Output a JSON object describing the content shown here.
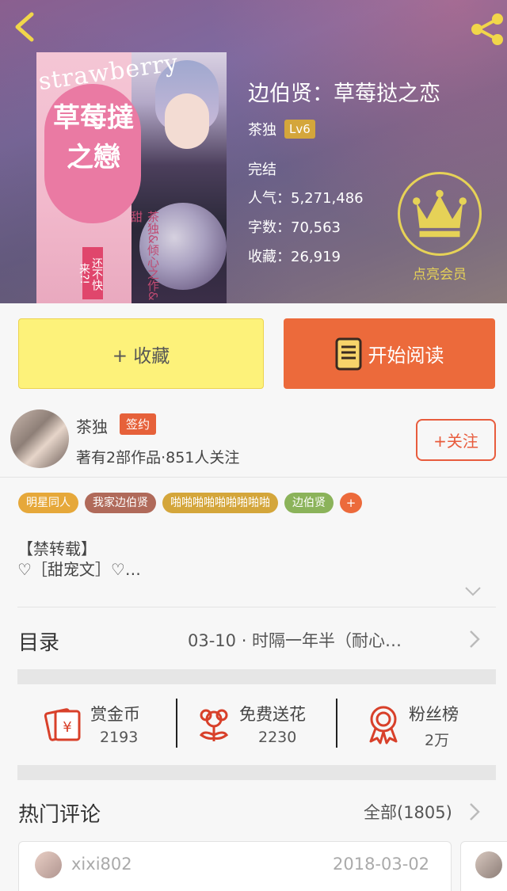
{
  "book": {
    "cover_en": "strawberry",
    "cover_title": "草莓撻之戀",
    "cover_tag": "还不快来?!",
    "cover_vertical": "茶独&倾心之作&甜",
    "title": "边伯贤：草莓挞之恋",
    "author": "茶独",
    "level": "Lv6",
    "status": "完结",
    "popularity": "人气：5,271,486",
    "words": "字数：70,563",
    "collects": "收藏：26,919",
    "vip_label": "点亮会员"
  },
  "actions": {
    "collect_label": "+ 收藏",
    "read_label": "开始阅读"
  },
  "author_section": {
    "name": "茶独",
    "badge": "签约",
    "desc": "著有2部作品·851人关注",
    "follow_label": "+关注"
  },
  "tags": [
    {
      "label": "明星同人",
      "color": "#e6a83a"
    },
    {
      "label": "我家边伯贤",
      "color": "#b06a5a"
    },
    {
      "label": "啪啪啪啪啪啪啪啪啪",
      "color": "#d4a63b"
    },
    {
      "label": "边伯贤",
      "color": "#8bb35a"
    }
  ],
  "tag_more": "+",
  "synopsis": {
    "line1": "【禁转载】",
    "line2": "♡［甜宠文］♡…"
  },
  "toc": {
    "label": "目录",
    "latest": "03-10 · 时隔一年半（耐心…"
  },
  "rewards": [
    {
      "label": "赏金币",
      "value": "2193",
      "icon": "coin-envelope-icon"
    },
    {
      "label": "免费送花",
      "value": "2230",
      "icon": "flower-icon"
    },
    {
      "label": "粉丝榜",
      "value": "2万",
      "icon": "medal-icon"
    }
  ],
  "comments": {
    "title": "热门评论",
    "all_label": "全部(1805)",
    "items": [
      {
        "user": "xixi802",
        "date": "2018-03-02"
      }
    ]
  },
  "colors": {
    "accent_orange": "#ec6a3b",
    "collect_yellow": "#fdf27a",
    "vip_gold": "#e6d257",
    "icon_red": "#d8402a"
  }
}
